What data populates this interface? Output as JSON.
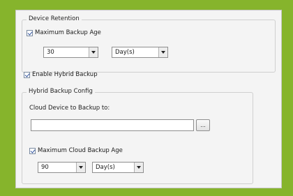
{
  "device_retention": {
    "legend": "Device Retention",
    "max_backup_age": {
      "label": "Maximum Backup Age",
      "checked": true,
      "value": "30",
      "unit": "Day(s)"
    }
  },
  "enable_hybrid": {
    "label": "Enable Hybrid Backup",
    "checked": true
  },
  "hybrid_config": {
    "legend": "Hybrid Backup Config",
    "cloud_device_label": "Cloud Device to Backup to:",
    "cloud_device_value": "",
    "browse_label": "...",
    "max_cloud_age": {
      "label": "Maximum Cloud Backup Age",
      "checked": true,
      "value": "90",
      "unit": "Day(s)"
    }
  }
}
